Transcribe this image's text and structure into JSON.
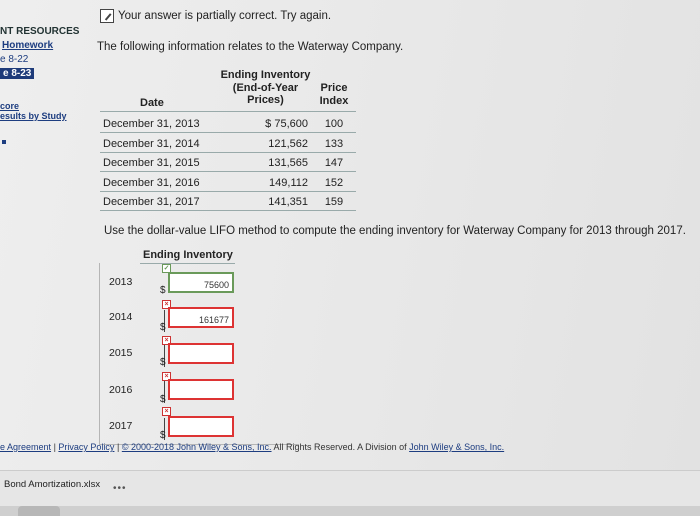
{
  "sidebar": {
    "heading": "NT RESOURCES",
    "homework_link": "Homework",
    "items": [
      "e 8-22",
      "e 8-23"
    ],
    "active_index": 1,
    "score_label": "core",
    "results_link": "esults by Study"
  },
  "status": {
    "message": "Your answer is partially correct.  Try again."
  },
  "intro": "The following information relates to the Waterway Company.",
  "table": {
    "headers": {
      "date": "Date",
      "inventory": [
        "Ending Inventory",
        "(End-of-Year",
        "Prices)"
      ],
      "price_index": [
        "Price",
        "Index"
      ]
    },
    "rows": [
      {
        "date": "December 31, 2013",
        "inventory": "$ 75,600",
        "index": "100"
      },
      {
        "date": "December 31, 2014",
        "inventory": "121,562",
        "index": "133"
      },
      {
        "date": "December 31, 2015",
        "inventory": "131,565",
        "index": "147"
      },
      {
        "date": "December 31, 2016",
        "inventory": "149,112",
        "index": "152"
      },
      {
        "date": "December 31, 2017",
        "inventory": "141,351",
        "index": "159"
      }
    ]
  },
  "instruction": "Use the dollar-value LIFO method to compute the ending inventory for Waterway Company for 2013 through 2017.",
  "answer": {
    "header": "Ending Inventory",
    "currency": "$",
    "rows": [
      {
        "year": "2013",
        "value": "75600",
        "status": "correct"
      },
      {
        "year": "2014",
        "value": "161677",
        "status": "incorrect"
      },
      {
        "year": "2015",
        "value": "",
        "status": "incorrect"
      },
      {
        "year": "2016",
        "value": "",
        "status": "incorrect"
      },
      {
        "year": "2017",
        "value": "",
        "status": "incorrect"
      }
    ]
  },
  "footer": {
    "agreement": "e Agreement",
    "separator": "|",
    "privacy": "Privacy Policy",
    "copyright_link": "© 2000-2018 John Wiley & Sons, Inc.",
    "rights": "All Rights Reserved. A Division of",
    "company_link": "John Wiley & Sons, Inc."
  },
  "download": {
    "filename": "Bond Amortization.xlsx",
    "more": "•••"
  },
  "colors": {
    "correct": "#6a9a5a",
    "incorrect": "#d33333",
    "link": "#1d3d80",
    "active": "#1e3b7a"
  }
}
